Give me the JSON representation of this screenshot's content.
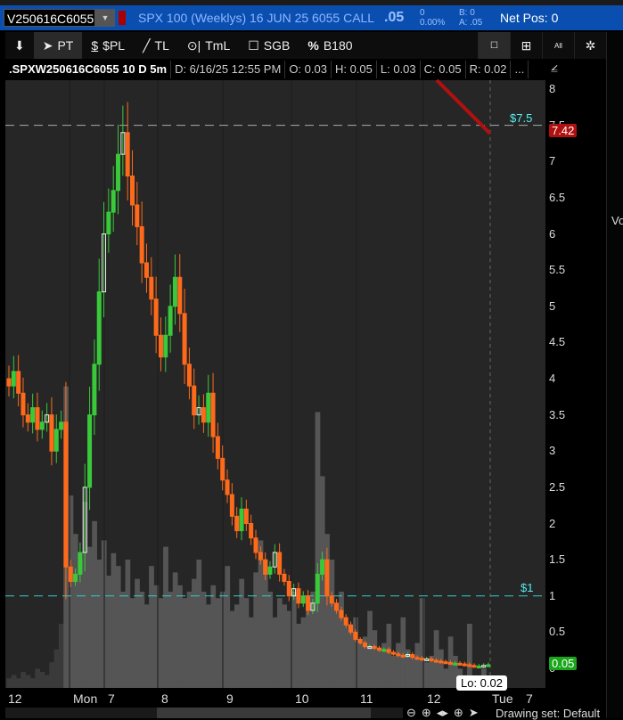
{
  "quote": {
    "symbol": "V250616C6055",
    "description": "SPX 100 (Weeklys) 16 JUN 25 6055 CALL",
    "last": ".05",
    "change": "0",
    "change_pct": "0.00%",
    "bid": "B: 0",
    "ask": "A: .05",
    "net_pos": "Net Pos: 0"
  },
  "toolbar": {
    "items": [
      {
        "label": "",
        "icon": "pin-icon"
      },
      {
        "label": "PT",
        "icon": "pointer-icon"
      },
      {
        "label": "$PL",
        "icon": "dollar-icon"
      },
      {
        "label": "TL",
        "icon": "trendline-icon"
      },
      {
        "label": "TmL",
        "icon": "timeline-icon"
      },
      {
        "label": "SGB",
        "icon": "square-icon"
      },
      {
        "label": "B180",
        "icon": "percent-icon"
      }
    ],
    "right_icons": [
      "window-icon",
      "grid-icon",
      "all-icon",
      "gear-icon"
    ],
    "all_label": "All"
  },
  "info": {
    "title": ".SPXW250616C6055 10 D 5m",
    "date": "D: 6/16/25 12:55 PM",
    "open": "O: 0.03",
    "high": "H: 0.05",
    "low": "L: 0.03",
    "close": "C: 0.05",
    "range": "R: 0.02",
    "more": "..."
  },
  "levels": {
    "upper": "$7.5",
    "lower": "$1"
  },
  "tags": {
    "red": "7.42",
    "green": "0.05",
    "red_color": "#b01010",
    "green_color": "#1aa51a"
  },
  "lo_label": "Lo: 0.02",
  "right_panel_label": "Vo",
  "drawing_set": "Drawing set: Default",
  "chart_data": {
    "type": "candlestick",
    "ylim": [
      0,
      8
    ],
    "yticks": [
      "0",
      "0.5",
      "1",
      "1.5",
      "2",
      "2.5",
      "3",
      "3.5",
      "4",
      "4.5",
      "5",
      "5.5",
      "6",
      "6.5",
      "7",
      "7.5",
      "8"
    ],
    "xticks": [
      "12",
      "Mon",
      "7",
      "8",
      "9",
      "10",
      "11",
      "12",
      "Tue",
      "7"
    ],
    "close": [
      3.9,
      4.1,
      3.8,
      3.5,
      3.4,
      3.6,
      3.3,
      3.4,
      3.5,
      3.0,
      3.3,
      3.4,
      1.4,
      1.2,
      1.3,
      1.6,
      2.5,
      3.5,
      4.2,
      5.2,
      6.0,
      6.3,
      6.6,
      7.1,
      7.4,
      6.8,
      6.4,
      6.1,
      5.6,
      5.4,
      5.1,
      4.6,
      4.3,
      4.6,
      5.0,
      5.4,
      4.9,
      4.2,
      3.9,
      3.5,
      3.6,
      3.4,
      3.8,
      3.2,
      2.9,
      2.6,
      2.4,
      2.1,
      1.9,
      2.2,
      2.0,
      1.8,
      1.6,
      1.5,
      1.3,
      1.4,
      1.6,
      1.3,
      1.2,
      1.0,
      1.1,
      0.9,
      1.0,
      0.8,
      0.9,
      1.3,
      1.5,
      1.0,
      0.9,
      0.8,
      0.7,
      0.6,
      0.5,
      0.4,
      0.35,
      0.3,
      0.3,
      0.28,
      0.25,
      0.26,
      0.22,
      0.2,
      0.18,
      0.17,
      0.19,
      0.15,
      0.14,
      0.12,
      0.13,
      0.11,
      0.1,
      0.09,
      0.08,
      0.07,
      0.07,
      0.06,
      0.05,
      0.04,
      0.03,
      0.03,
      0.04,
      0.05
    ],
    "volume": [
      3,
      4,
      3,
      5,
      4,
      3,
      6,
      5,
      4,
      8,
      12,
      20,
      94,
      60,
      48,
      40,
      58,
      44,
      52,
      40,
      46,
      35,
      42,
      38,
      30,
      40,
      28,
      34,
      30,
      26,
      38,
      32,
      28,
      44,
      30,
      36,
      32,
      28,
      30,
      34,
      40,
      30,
      26,
      32,
      28,
      30,
      38,
      24,
      26,
      34,
      28,
      22,
      36,
      46,
      40,
      30,
      22,
      28,
      26,
      24,
      30,
      20,
      22,
      28,
      30,
      86,
      66,
      48,
      40,
      24,
      30,
      20,
      18,
      22,
      14,
      16,
      24,
      18,
      12,
      14,
      20,
      10,
      14,
      22,
      12,
      10,
      14,
      28,
      8,
      10,
      18,
      12,
      6,
      16,
      10,
      6,
      4,
      20,
      3,
      2,
      6,
      3
    ],
    "hlines": [
      7.5,
      1
    ]
  }
}
